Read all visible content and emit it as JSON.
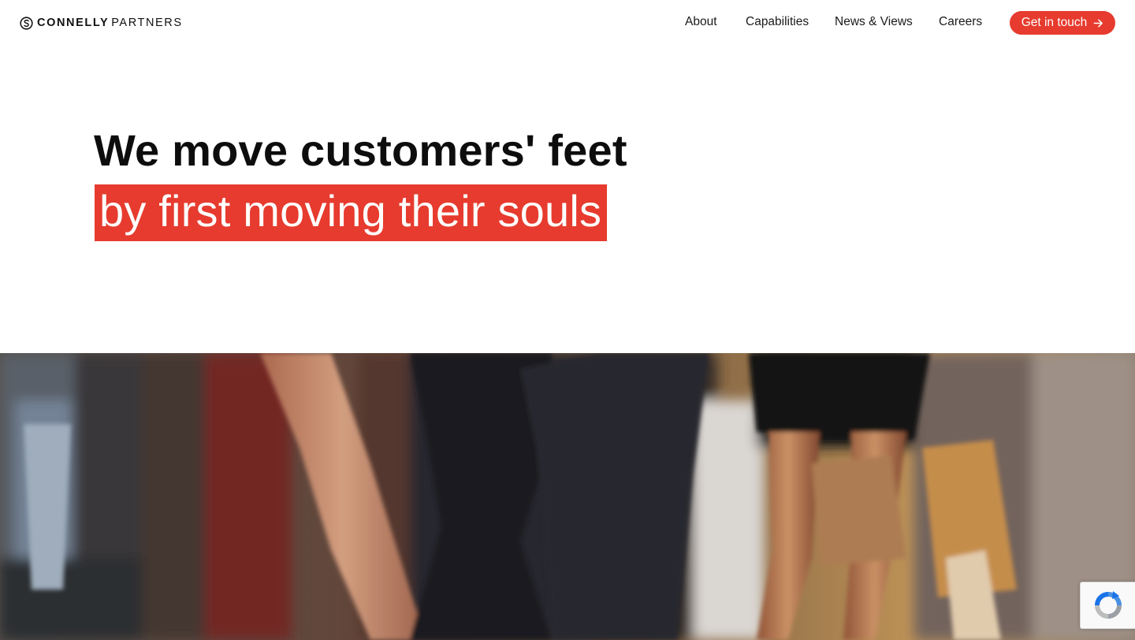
{
  "brand": {
    "name_bold": "CONNELLY",
    "name_light": "PARTNERS",
    "accent_color": "#e63b2e"
  },
  "nav": {
    "items": [
      {
        "label": "About"
      },
      {
        "label": "Capabilities"
      },
      {
        "label": "News & Views"
      },
      {
        "label": "Careers"
      }
    ],
    "cta_label": "Get in touch",
    "cta_icon": "arrow-right-icon"
  },
  "hero": {
    "line1": "We move customers' feet",
    "line2": "by first moving their souls"
  },
  "media": {
    "description_icon": "hero-video"
  },
  "recaptcha": {
    "icon": "recaptcha-icon"
  }
}
